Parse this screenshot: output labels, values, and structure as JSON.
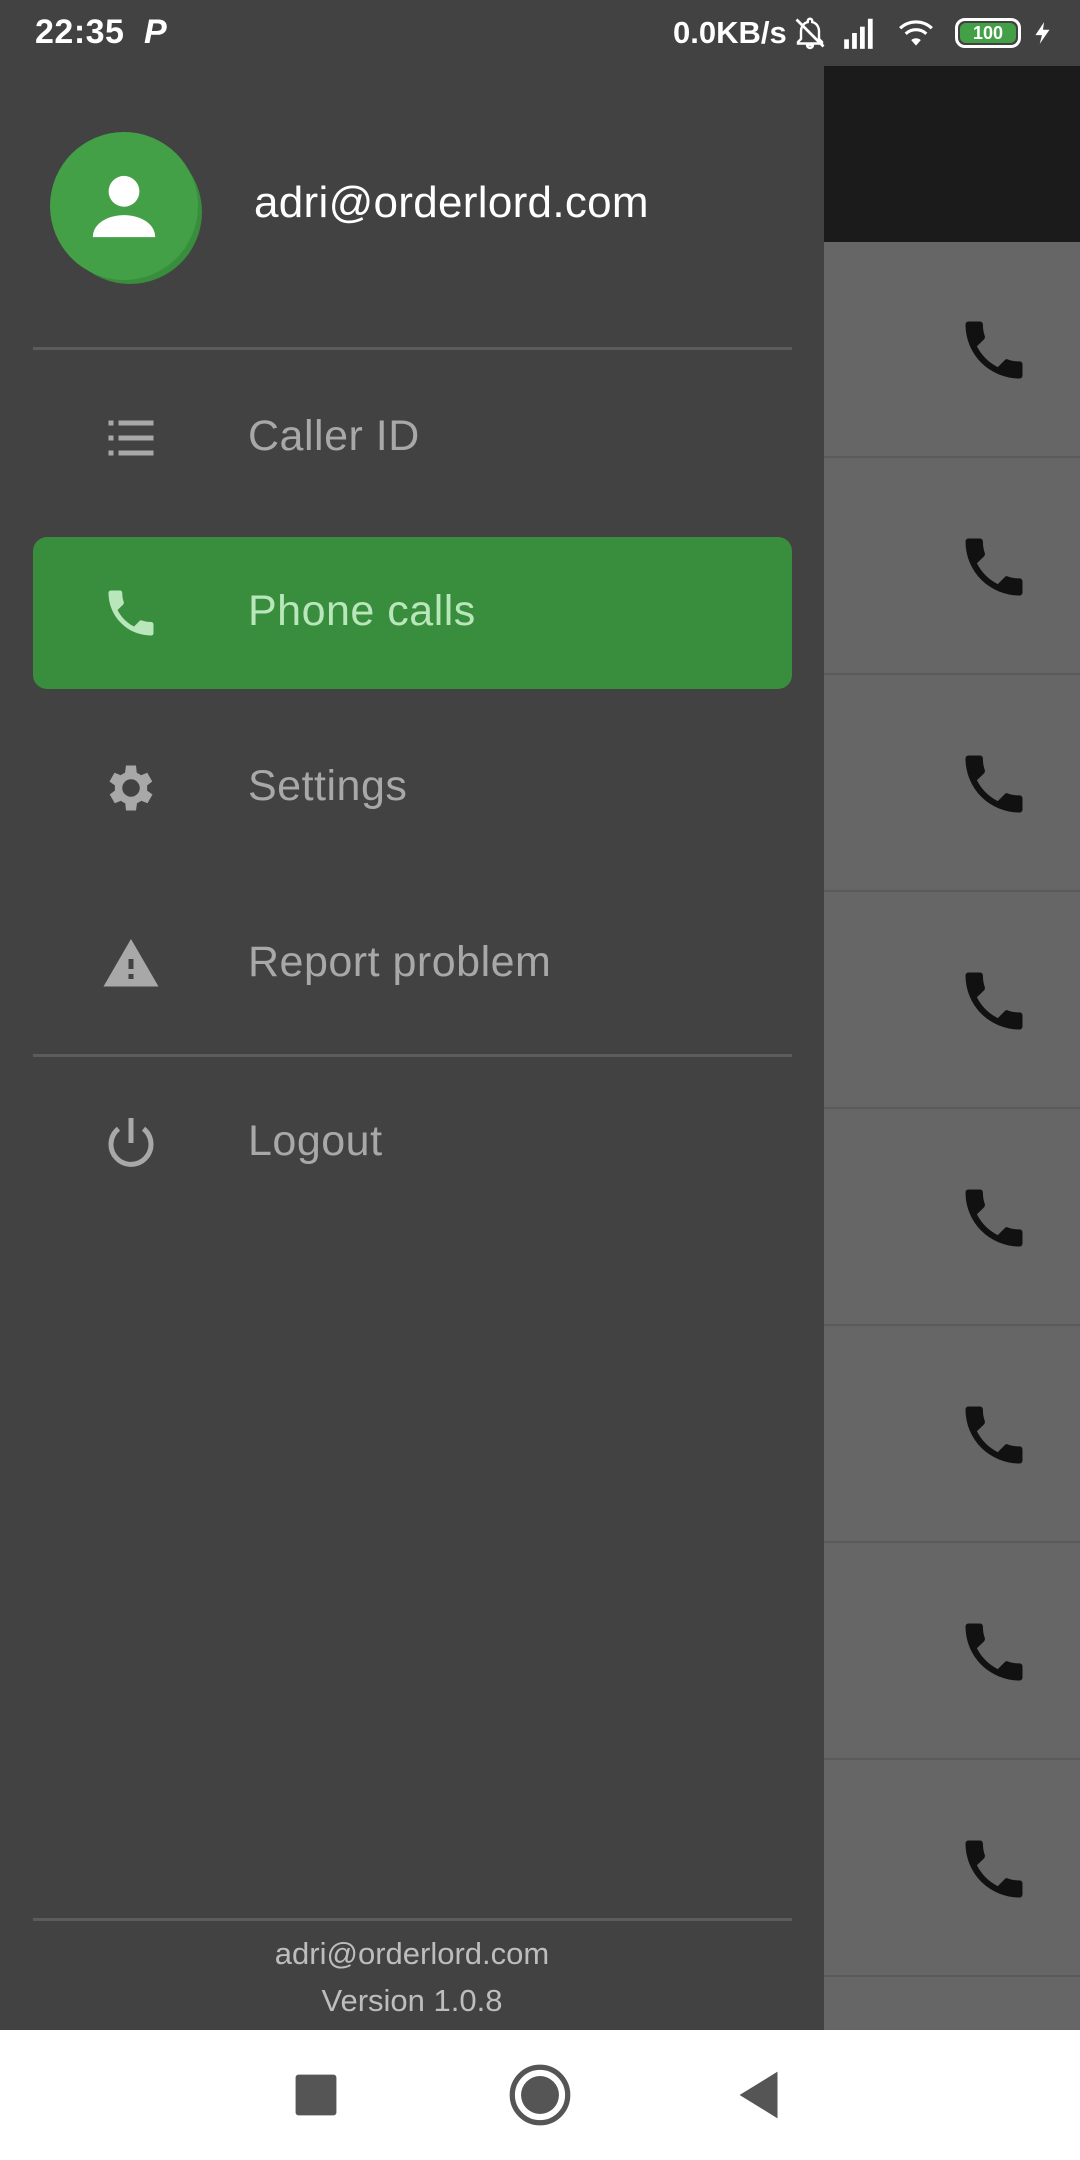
{
  "status_bar": {
    "time": "22:35",
    "app_indicator": "P",
    "network_speed": "0.0KB/s",
    "battery_level": "100",
    "icons": [
      "mute-icon",
      "signal-icon",
      "wifi-icon",
      "battery-icon",
      "charging-icon"
    ]
  },
  "drawer": {
    "account_email": "adri@orderlord.com",
    "menu": [
      {
        "label": "Caller ID",
        "icon": "list-icon",
        "active": false
      },
      {
        "label": "Phone calls",
        "icon": "phone-icon",
        "active": true
      },
      {
        "label": "Settings",
        "icon": "gear-icon",
        "active": false
      },
      {
        "label": "Report problem",
        "icon": "warning-icon",
        "active": false
      },
      {
        "label": "Logout",
        "icon": "power-icon",
        "active": false
      }
    ],
    "footer": {
      "email": "adri@orderlord.com",
      "version": "Version 1.0.8"
    }
  },
  "background_list": {
    "row_icon": "phone-icon",
    "row_count": 8
  },
  "colors": {
    "drawer_bg": "#424242",
    "accent": "#388e3c",
    "avatar": "#43a047",
    "active_label": "#b9e6bb",
    "inactive_label": "#a8a8a8"
  }
}
